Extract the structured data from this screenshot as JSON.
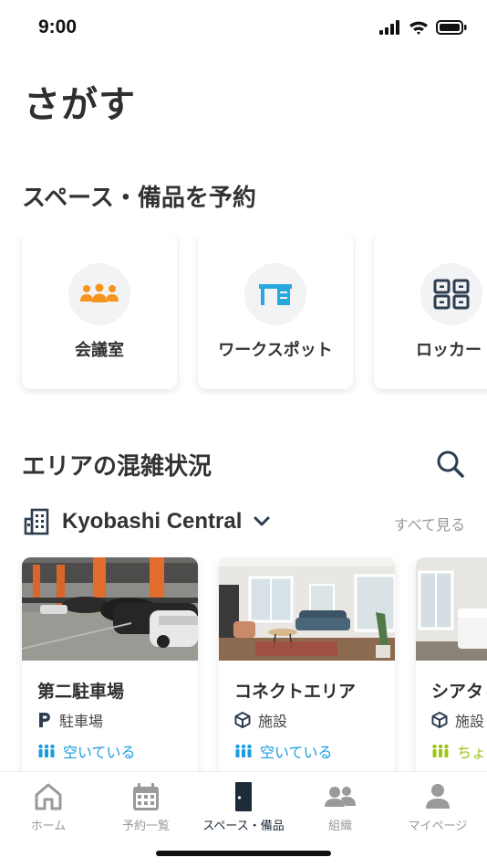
{
  "status": {
    "time": "9:00"
  },
  "page": {
    "title": "さがす"
  },
  "reserve": {
    "title": "スペース・備品を予約",
    "categories": [
      {
        "label": "会議室",
        "icon": "people-group-icon",
        "color": "#f7941d"
      },
      {
        "label": "ワークスポット",
        "icon": "desk-icon",
        "color": "#29a8e0"
      },
      {
        "label": "ロッカー",
        "icon": "locker-grid-icon",
        "color": "#2d3e50"
      }
    ]
  },
  "area": {
    "title": "エリアの混雑状況",
    "building": "Kyobashi Central",
    "see_all": "すべて見る",
    "cards": [
      {
        "name": "第二駐車場",
        "type": "駐車場",
        "type_icon": "parking-icon",
        "status": "空いている",
        "status_color": "#1a9de0"
      },
      {
        "name": "コネクトエリア",
        "type": "施設",
        "type_icon": "box-icon",
        "status": "空いている",
        "status_color": "#1a9de0"
      },
      {
        "name": "シアタ",
        "type": "施設",
        "type_icon": "box-icon",
        "status": "ちょ",
        "status_color": "#9cc414"
      }
    ]
  },
  "tabs": [
    {
      "label": "ホーム",
      "icon": "home-icon"
    },
    {
      "label": "予約一覧",
      "icon": "calendar-icon"
    },
    {
      "label": "スペース・備品",
      "icon": "door-icon",
      "active": true
    },
    {
      "label": "組織",
      "icon": "group-icon"
    },
    {
      "label": "マイページ",
      "icon": "person-icon"
    }
  ]
}
